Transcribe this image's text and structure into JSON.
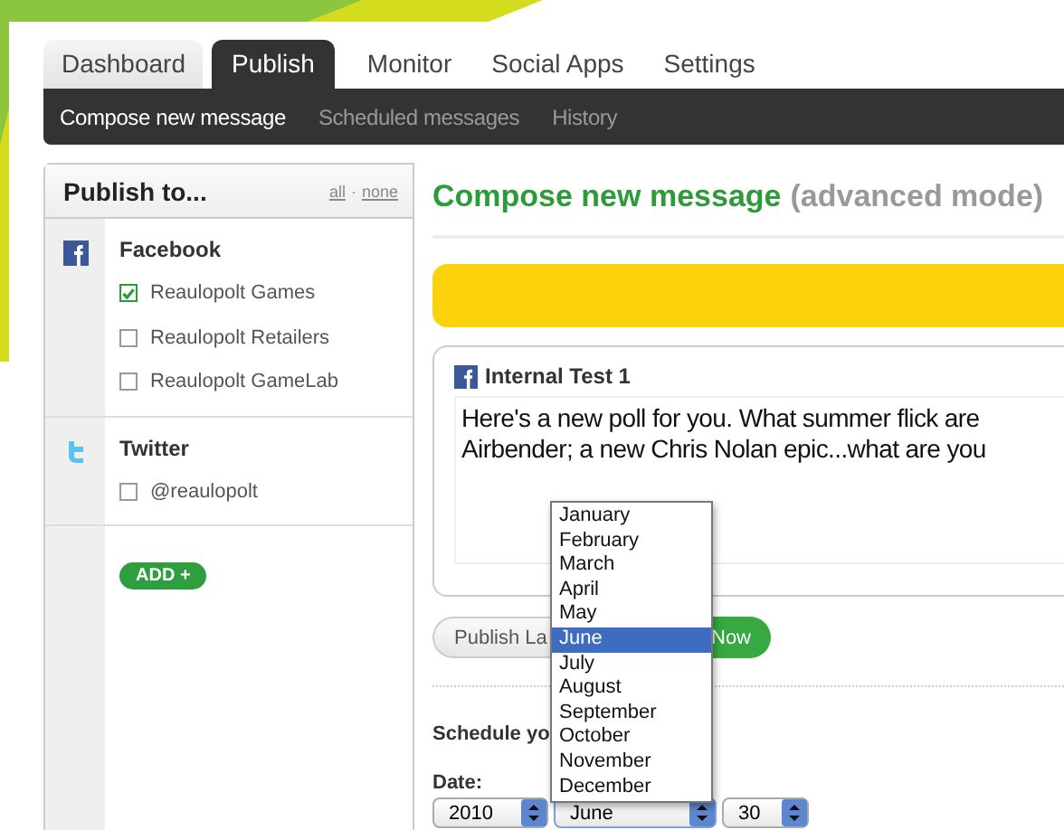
{
  "tabs": [
    {
      "label": "Dashboard",
      "selected": false
    },
    {
      "label": "Publish",
      "selected": true
    },
    {
      "label": "Monitor",
      "selected": false
    },
    {
      "label": "Social Apps",
      "selected": false
    },
    {
      "label": "Settings",
      "selected": false
    }
  ],
  "subnav": [
    {
      "label": "Compose new message",
      "selected": true
    },
    {
      "label": "Scheduled messages",
      "selected": false
    },
    {
      "label": "History",
      "selected": false
    }
  ],
  "sidebar": {
    "title": "Publish to...",
    "all_link": "all",
    "separator": "·",
    "none_link": "none",
    "networks": [
      {
        "kind": "facebook",
        "name": "Facebook",
        "accounts": [
          {
            "label": "Reaulopolt Games",
            "checked": true
          },
          {
            "label": "Reaulopolt Retailers",
            "checked": false
          },
          {
            "label": "Reaulopolt GameLab",
            "checked": false
          }
        ]
      },
      {
        "kind": "twitter",
        "name": "Twitter",
        "accounts": [
          {
            "label": "@reaulopolt",
            "checked": false
          }
        ]
      }
    ],
    "add_button": "ADD +"
  },
  "main": {
    "title": "Compose new message",
    "title_note": "(advanced mode)",
    "message": {
      "kind": "facebook",
      "account": "Internal Test 1",
      "lines": [
        "Here's a new poll for you. What summer flick are",
        "Airbender; a new Chris Nolan epic...what are you"
      ]
    },
    "publish_later": "Publish La",
    "publish_now": "Now",
    "schedule_heading": "Schedule yo",
    "date_label": "Date:",
    "year": "2010",
    "month": "June",
    "day": "30",
    "month_options": [
      {
        "label": "January",
        "selected": false
      },
      {
        "label": "February",
        "selected": false
      },
      {
        "label": "March",
        "selected": false
      },
      {
        "label": "April",
        "selected": false
      },
      {
        "label": "May",
        "selected": false
      },
      {
        "label": "June",
        "selected": true
      },
      {
        "label": "July",
        "selected": false
      },
      {
        "label": "August",
        "selected": false
      },
      {
        "label": "September",
        "selected": false
      },
      {
        "label": "October",
        "selected": false
      },
      {
        "label": "November",
        "selected": false
      },
      {
        "label": "December",
        "selected": false
      }
    ]
  }
}
